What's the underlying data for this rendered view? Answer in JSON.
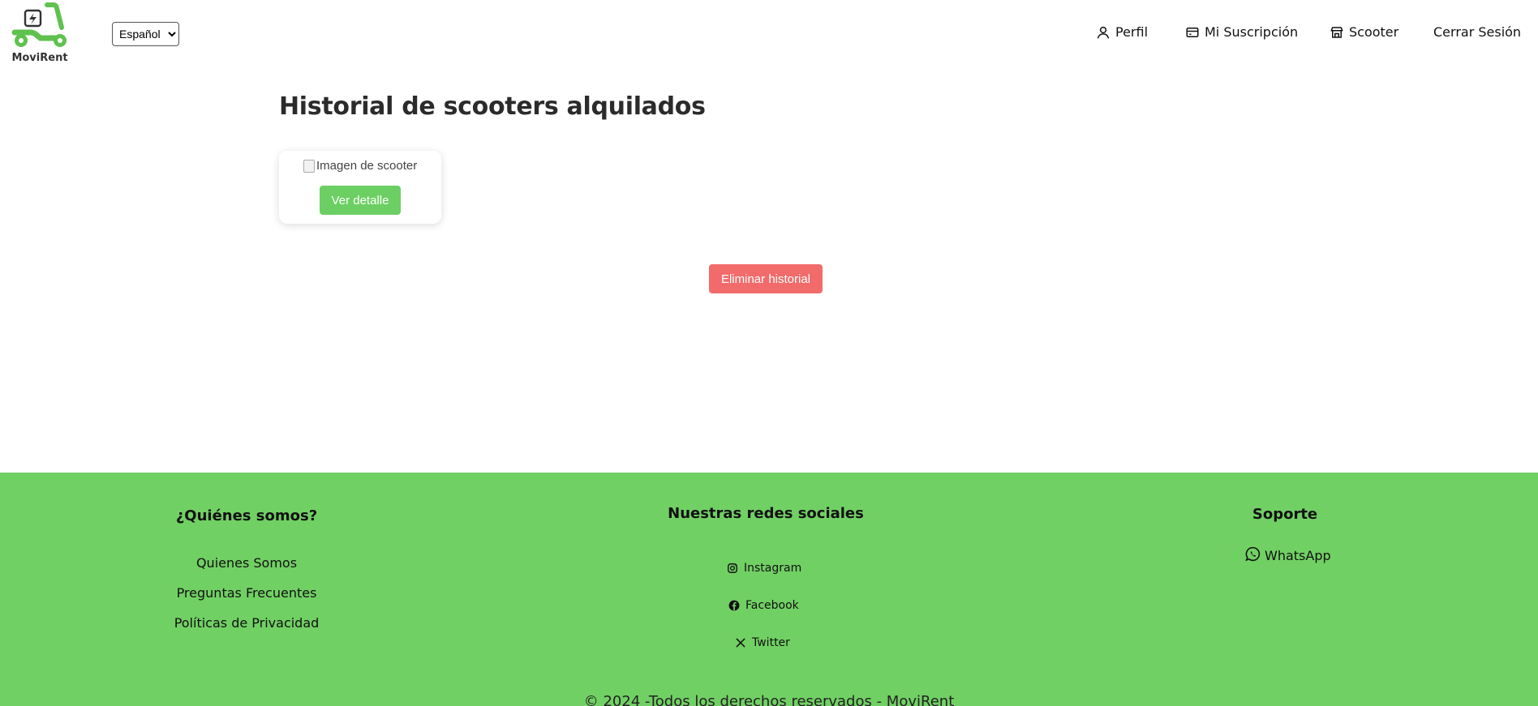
{
  "app": {
    "name": "MoviRent",
    "accent": "#71d064",
    "danger": "#f26b6b"
  },
  "header": {
    "language": {
      "selected": "Español",
      "options": [
        "Español"
      ]
    },
    "nav": [
      {
        "label": "Perfil",
        "icon": "user-icon"
      },
      {
        "label": "Mi Suscripción",
        "icon": "credit-card-icon"
      },
      {
        "label": "Scooter",
        "icon": "store-icon"
      },
      {
        "label": "Cerrar Sesión",
        "icon": ""
      }
    ]
  },
  "main": {
    "title": "Historial de scooters alquilados",
    "card": {
      "image_alt": "Imagen de scooter",
      "detail_label": "Ver detalle"
    },
    "delete_label": "Eliminar historial"
  },
  "footer": {
    "about": {
      "heading": "¿Quiénes somos?",
      "links": [
        "Quienes Somos",
        "Preguntas Frecuentes",
        "Políticas de Privacidad"
      ]
    },
    "social": {
      "heading": "Nuestras redes sociales",
      "links": [
        {
          "label": "Instagram",
          "icon": "instagram-icon"
        },
        {
          "label": "Facebook",
          "icon": "facebook-icon"
        },
        {
          "label": "Twitter",
          "icon": "x-twitter-icon"
        }
      ]
    },
    "support": {
      "heading": "Soporte",
      "link": {
        "label": "WhatsApp",
        "icon": "whatsapp-icon"
      }
    },
    "copyright": "© 2024 -Todos los derechos reservados - MoviRent"
  }
}
